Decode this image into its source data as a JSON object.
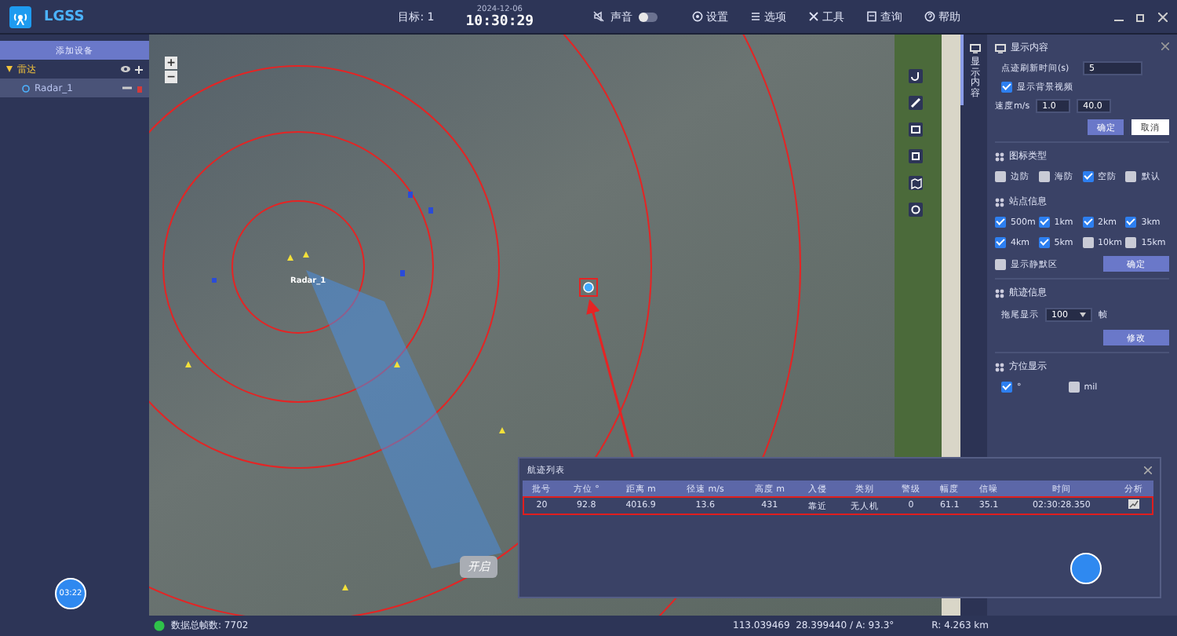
{
  "header": {
    "app_title": "LGSS",
    "target_count": "目标: 1",
    "date": "2024-12-06",
    "time": "10:30:29",
    "sound": {
      "label": "声音",
      "on": false
    },
    "menu": [
      {
        "label": "设置",
        "kind": "gear"
      },
      {
        "label": "选项",
        "kind": "options"
      },
      {
        "label": "工具",
        "kind": "tools"
      },
      {
        "label": "查询",
        "kind": "search"
      },
      {
        "label": "帮助",
        "kind": "help"
      }
    ]
  },
  "sidebar": {
    "add_button": "添加设备",
    "groups": [
      {
        "label": "雷达",
        "expanded": true,
        "children": [
          {
            "label": "Radar_1",
            "selected": true
          }
        ]
      }
    ]
  },
  "map": {
    "zoom_in": "+",
    "zoom_out": "−",
    "radar_label": "Radar_1",
    "overlay_button": "开启",
    "clock_button": "03:22"
  },
  "right_panel": {
    "tab": {
      "label": "显示内容",
      "selected": true
    },
    "display": {
      "title": "显示内容",
      "refresh_label": "点迹刷新时间(s)",
      "refresh_value": "5",
      "video": {
        "label": "显示背景视频",
        "checked": true
      },
      "speed_label": "速度m/s",
      "speed_min": "1.0",
      "speed_max": "40.0",
      "ok": "确定",
      "cancel": "取消"
    },
    "icon_type": {
      "title": "图标类型",
      "options": [
        {
          "label": "边防",
          "checked": false
        },
        {
          "label": "海防",
          "checked": false
        },
        {
          "label": "空防",
          "checked": true
        },
        {
          "label": "默认",
          "checked": false
        }
      ]
    },
    "site_info": {
      "title": "站点信息",
      "ranges": [
        {
          "label": "500m",
          "checked": true
        },
        {
          "label": "1km",
          "checked": true
        },
        {
          "label": "2km",
          "checked": true
        },
        {
          "label": "3km",
          "checked": true
        },
        {
          "label": "4km",
          "checked": true
        },
        {
          "label": "5km",
          "checked": true
        },
        {
          "label": "10km",
          "checked": false
        },
        {
          "label": "15km",
          "checked": false
        }
      ],
      "silent": {
        "label": "显示静默区",
        "checked": false
      },
      "ok": "确定"
    },
    "track_info": {
      "title": "航迹信息",
      "tail_label": "拖尾显示",
      "tail_value": "100",
      "tail_unit": "帧",
      "modify": "修改"
    },
    "bearing": {
      "title": "方位显示",
      "options": [
        {
          "label": "°",
          "checked": true
        },
        {
          "label": "mil",
          "checked": false
        }
      ]
    }
  },
  "track_list": {
    "title": "航迹列表",
    "columns": [
      "批号",
      "方位 °",
      "距离 m",
      "径速 m/s",
      "高度 m",
      "入侵",
      "类别",
      "警级",
      "幅度",
      "信噪",
      "时间",
      "分析"
    ],
    "rows": [
      {
        "cells": [
          "20",
          "92.8",
          "4016.9",
          "13.6",
          "431",
          "靠近",
          "无人机",
          "0",
          "61.1",
          "35.1",
          "02:30:28.350"
        ],
        "selected": true
      }
    ]
  },
  "status_bar": {
    "frames": "数据总帧数: 7702",
    "coords": "113.039469  28.399440 / A: 93.3°",
    "range": "R: 4.263 km"
  }
}
